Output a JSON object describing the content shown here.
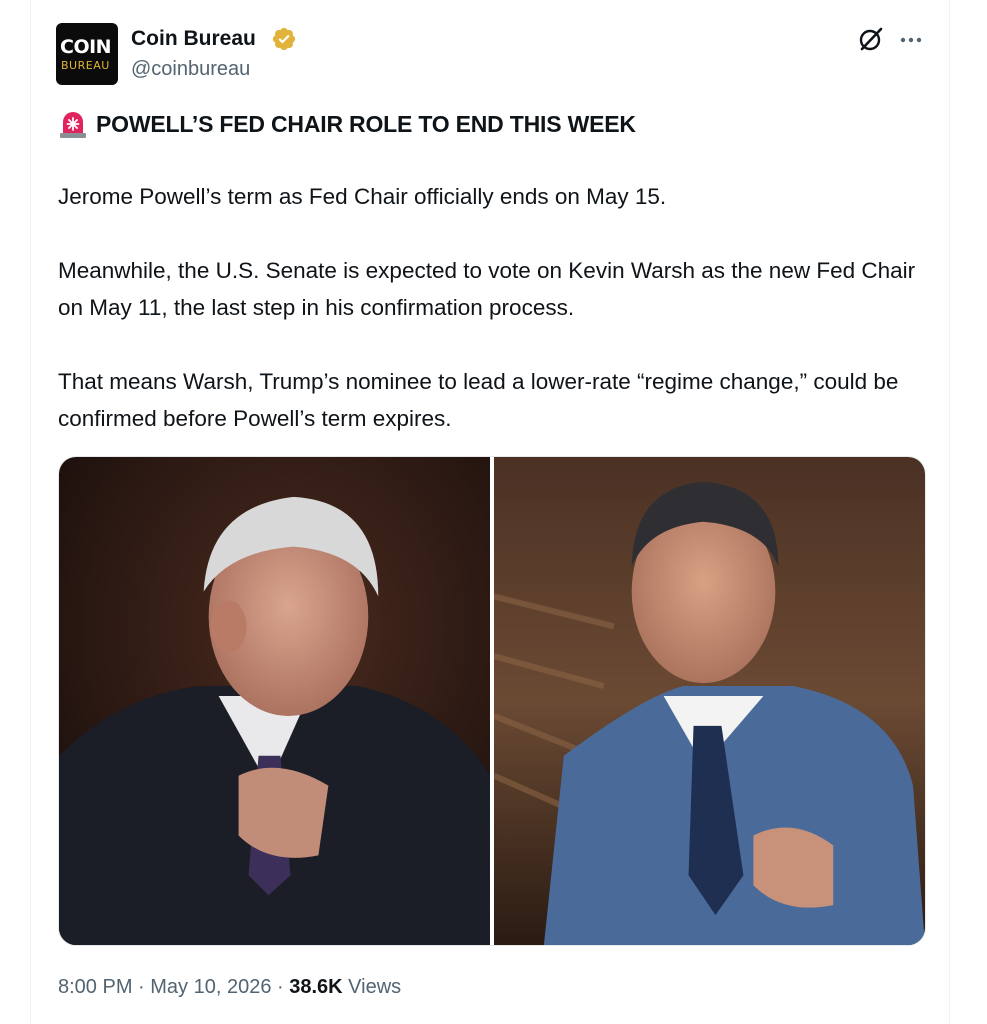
{
  "author": {
    "name": "Coin Bureau",
    "handle": "@coinbureau",
    "avatar_text_top": "COIN",
    "avatar_text_bottom": "BUREAU",
    "verified_color": "#e2b33b"
  },
  "actions": {
    "grok_icon": "grok-icon",
    "more_icon": "more-dots-icon"
  },
  "post": {
    "headline_emoji": "siren-icon",
    "headline": "POWELL’S FED CHAIR ROLE TO END THIS WEEK",
    "paragraphs": [
      "Jerome Powell’s term as Fed Chair officially ends on May 15.",
      "Meanwhile, the U.S. Senate is expected to vote on Kevin Warsh as the new Fed Chair on May 11, the last step in his confirmation process.",
      "That means Warsh, Trump’s nominee to lead a lower-rate “regime change,” could be confirmed before Powell’s term expires."
    ]
  },
  "meta": {
    "time": "8:00 PM",
    "separator": " · ",
    "date": "May 10, 2026",
    "views_count": "38.6K",
    "views_label": " Views"
  },
  "colors": {
    "text_primary": "#0f1419",
    "text_secondary": "#536471",
    "accent_gold": "#e2b33b",
    "siren_red": "#e0245e"
  }
}
